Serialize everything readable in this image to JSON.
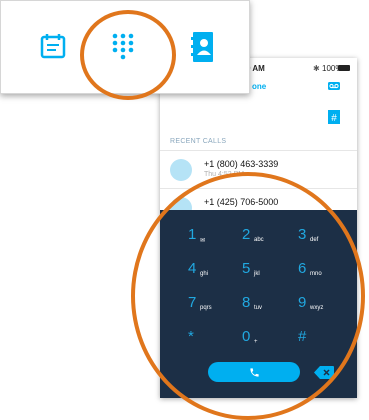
{
  "tabs": [
    {
      "icon": "calendar-chat-icon"
    },
    {
      "icon": "dialpad-icon"
    },
    {
      "icon": "contacts-icon"
    }
  ],
  "phone": {
    "status": {
      "time": "9 AM",
      "battery": "100%"
    },
    "header": {
      "title_fragment": "one"
    },
    "recent_label": "RECENT CALLS",
    "calls": [
      {
        "number": "+1 (800) 463-3339",
        "time": "Thu 4:52 PM"
      },
      {
        "number": "+1 (425) 706-5000"
      }
    ],
    "dialpad": {
      "keys": [
        {
          "num": "1",
          "letters": "✉"
        },
        {
          "num": "2",
          "letters": "abc"
        },
        {
          "num": "3",
          "letters": "def"
        },
        {
          "num": "4",
          "letters": "ghi"
        },
        {
          "num": "5",
          "letters": "jkl"
        },
        {
          "num": "6",
          "letters": "mno"
        },
        {
          "num": "7",
          "letters": "pqrs"
        },
        {
          "num": "8",
          "letters": "tuv"
        },
        {
          "num": "9",
          "letters": "wxyz"
        },
        {
          "num": "*",
          "letters": ""
        },
        {
          "num": "0",
          "letters": "+"
        },
        {
          "num": "#",
          "letters": ""
        }
      ]
    }
  },
  "colors": {
    "accent": "#00aff0",
    "highlight": "#e0761c",
    "dialpad_bg": "#1c2f46"
  }
}
